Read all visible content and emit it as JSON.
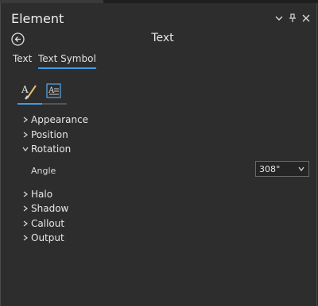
{
  "pane": {
    "title": "Element",
    "controls": {
      "menu_icon": "chevron-down-icon",
      "pin_icon": "pin-icon",
      "close_icon": "close-icon"
    }
  },
  "context": {
    "back_icon": "back-arrow-icon",
    "title": "Text"
  },
  "tabs": [
    {
      "label": "Text",
      "active": false
    },
    {
      "label": "Text Symbol",
      "active": true
    }
  ],
  "symbol_tabs": [
    {
      "icon": "brush-icon",
      "active": true
    },
    {
      "icon": "text-format-icon",
      "active": false
    }
  ],
  "groups": {
    "appearance": "Appearance",
    "position": "Position",
    "rotation": "Rotation",
    "halo": "Halo",
    "shadow": "Shadow",
    "callout": "Callout",
    "output": "Output"
  },
  "rotation": {
    "angle_label": "Angle",
    "angle_value": "308°"
  },
  "colors": {
    "accent": "#3d9be9",
    "background": "#2d2d2d"
  }
}
